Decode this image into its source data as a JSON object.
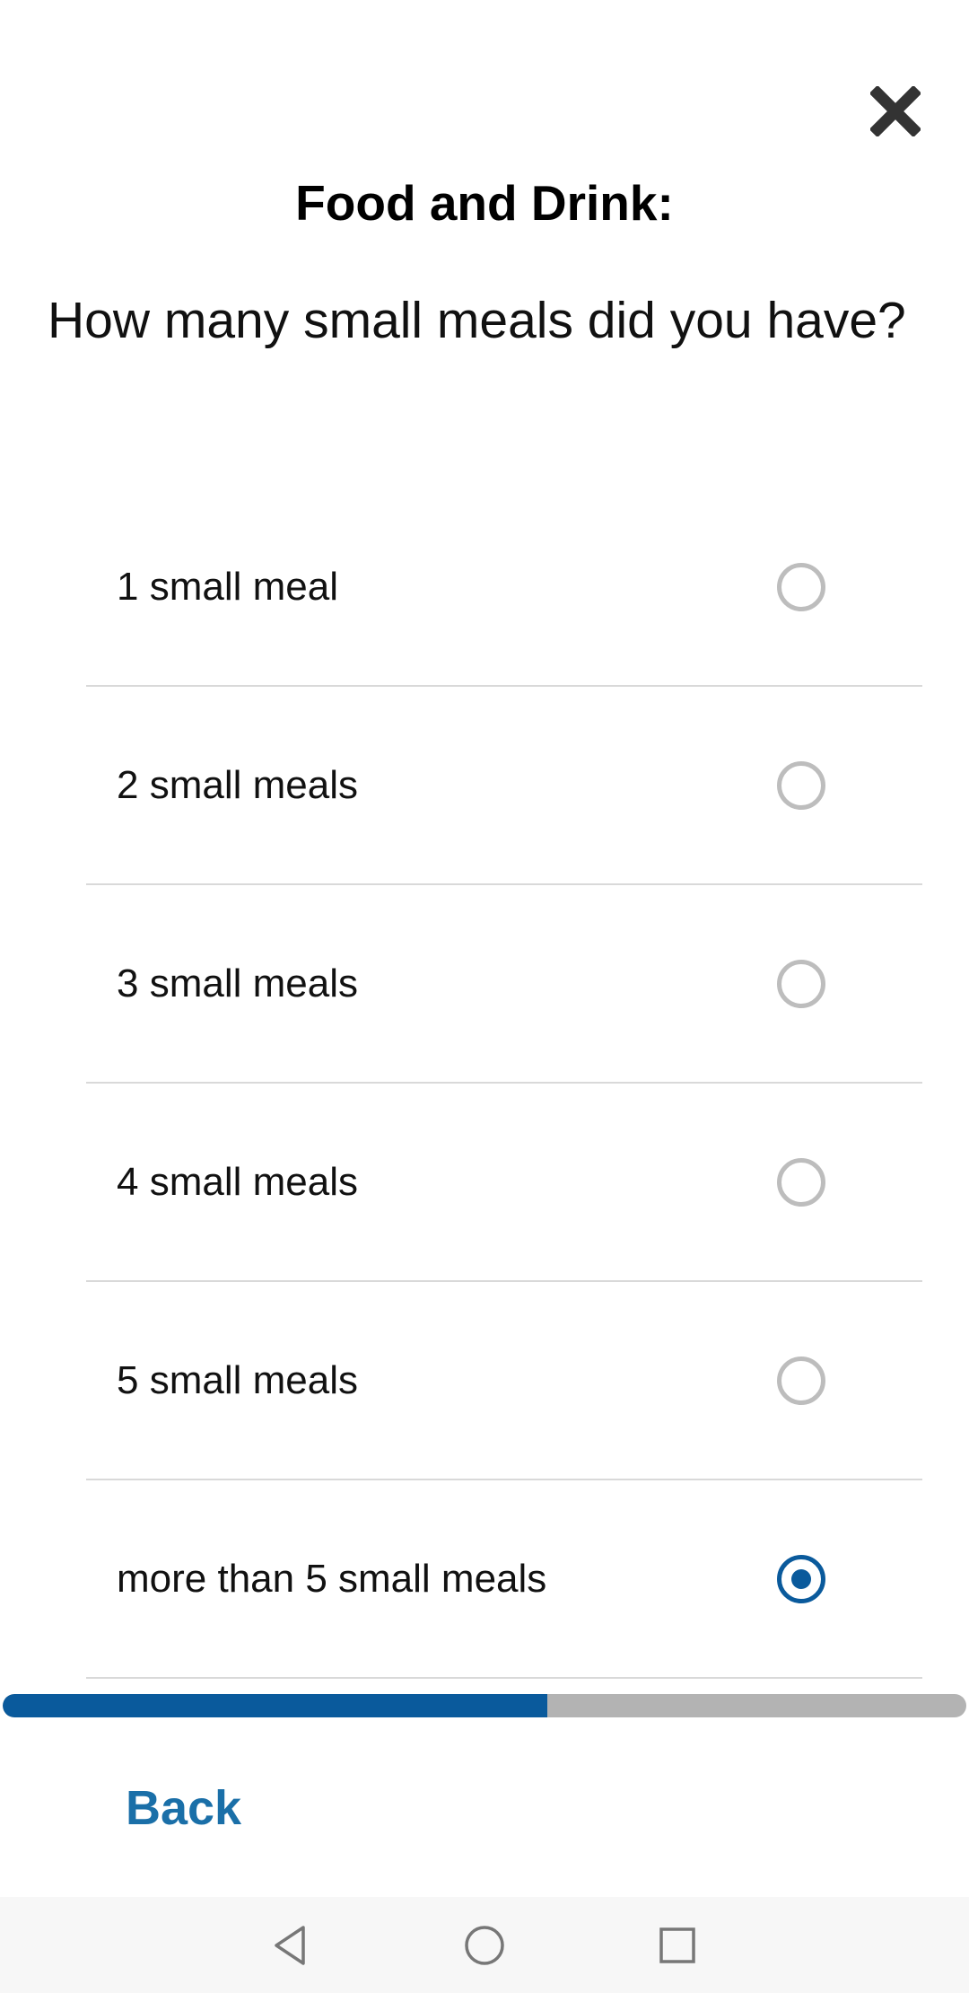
{
  "header": {
    "close_icon": "close-icon",
    "title": "Food and Drink:"
  },
  "question": {
    "text": "How many small meals did you have?"
  },
  "options": [
    {
      "label": "1 small meal",
      "selected": false
    },
    {
      "label": "2 small meals",
      "selected": false
    },
    {
      "label": "3 small meals",
      "selected": false
    },
    {
      "label": "4 small meals",
      "selected": false
    },
    {
      "label": "5 small meals",
      "selected": false
    },
    {
      "label": "more than 5 small meals",
      "selected": true
    }
  ],
  "progress": {
    "fraction": 0.565,
    "fill_color": "#0a5a9c",
    "track_color": "#b3b3b3"
  },
  "footer": {
    "back_label": "Back"
  },
  "navbar": {
    "icons": [
      "back-triangle-icon",
      "home-circle-icon",
      "recents-square-icon"
    ]
  },
  "colors": {
    "accent": "#0a5a9c",
    "link": "#1a6fa8",
    "radio_unselected": "#bdbdbd"
  }
}
